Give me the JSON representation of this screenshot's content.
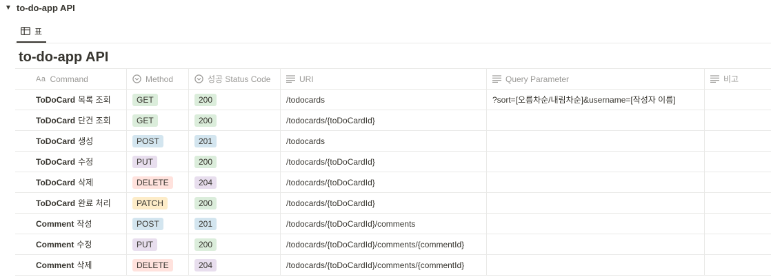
{
  "toggle": {
    "arrow": "▼",
    "title": "to-do-app API"
  },
  "view_tab": {
    "icon": "table-icon",
    "label": "표"
  },
  "database": {
    "title": "to-do-app API"
  },
  "columns": {
    "command": {
      "prefix": "Aa",
      "label": "Command"
    },
    "method": {
      "icon": "select-icon",
      "label": "Method"
    },
    "status": {
      "icon": "select-icon",
      "label": "성공 Status Code"
    },
    "uri": {
      "icon": "text-icon",
      "label": "URI"
    },
    "query": {
      "icon": "text-icon",
      "label": "Query Parameter"
    },
    "note": {
      "icon": "text-icon",
      "label": "비고"
    }
  },
  "method_colors": {
    "GET": "#dbeddb",
    "POST": "#d3e5ef",
    "PUT": "#e8deee",
    "DELETE": "#ffe2dd",
    "PATCH": "#fdecc8"
  },
  "status_colors": {
    "200": "#dbeddb",
    "201": "#d3e5ef",
    "204": "#e8deee"
  },
  "rows": [
    {
      "cmd_en": "ToDoCard",
      "cmd_ko": "목록 조회",
      "method": "GET",
      "status": "200",
      "uri": "/todocards",
      "query": "?sort=[오름차순/내림차순]&username=[작성자 이름]",
      "note": ""
    },
    {
      "cmd_en": "ToDoCard",
      "cmd_ko": "단건 조회",
      "method": "GET",
      "status": "200",
      "uri": "/todocards/{toDoCardId}",
      "query": "",
      "note": ""
    },
    {
      "cmd_en": "ToDoCard",
      "cmd_ko": "생성",
      "method": "POST",
      "status": "201",
      "uri": "/todocards",
      "query": "",
      "note": ""
    },
    {
      "cmd_en": "ToDoCard",
      "cmd_ko": "수정",
      "method": "PUT",
      "status": "200",
      "uri": "/todocards/{toDoCardId}",
      "query": "",
      "note": ""
    },
    {
      "cmd_en": "ToDoCard",
      "cmd_ko": "삭제",
      "method": "DELETE",
      "status": "204",
      "uri": "/todocards/{toDoCardId}",
      "query": "",
      "note": ""
    },
    {
      "cmd_en": "ToDoCard",
      "cmd_ko": "완료 처리",
      "method": "PATCH",
      "status": "200",
      "uri": "/todocards/{toDoCardId}",
      "query": "",
      "note": ""
    },
    {
      "cmd_en": "Comment",
      "cmd_ko": "작성",
      "method": "POST",
      "status": "201",
      "uri": "/todocards/{toDoCardId}/comments",
      "query": "",
      "note": ""
    },
    {
      "cmd_en": "Comment",
      "cmd_ko": "수정",
      "method": "PUT",
      "status": "200",
      "uri": "/todocards/{toDoCardId}/comments/{commentId}",
      "query": "",
      "note": ""
    },
    {
      "cmd_en": "Comment",
      "cmd_ko": "삭제",
      "method": "DELETE",
      "status": "204",
      "uri": "/todocards/{toDoCardId}/comments/{commentId}",
      "query": "",
      "note": ""
    }
  ]
}
